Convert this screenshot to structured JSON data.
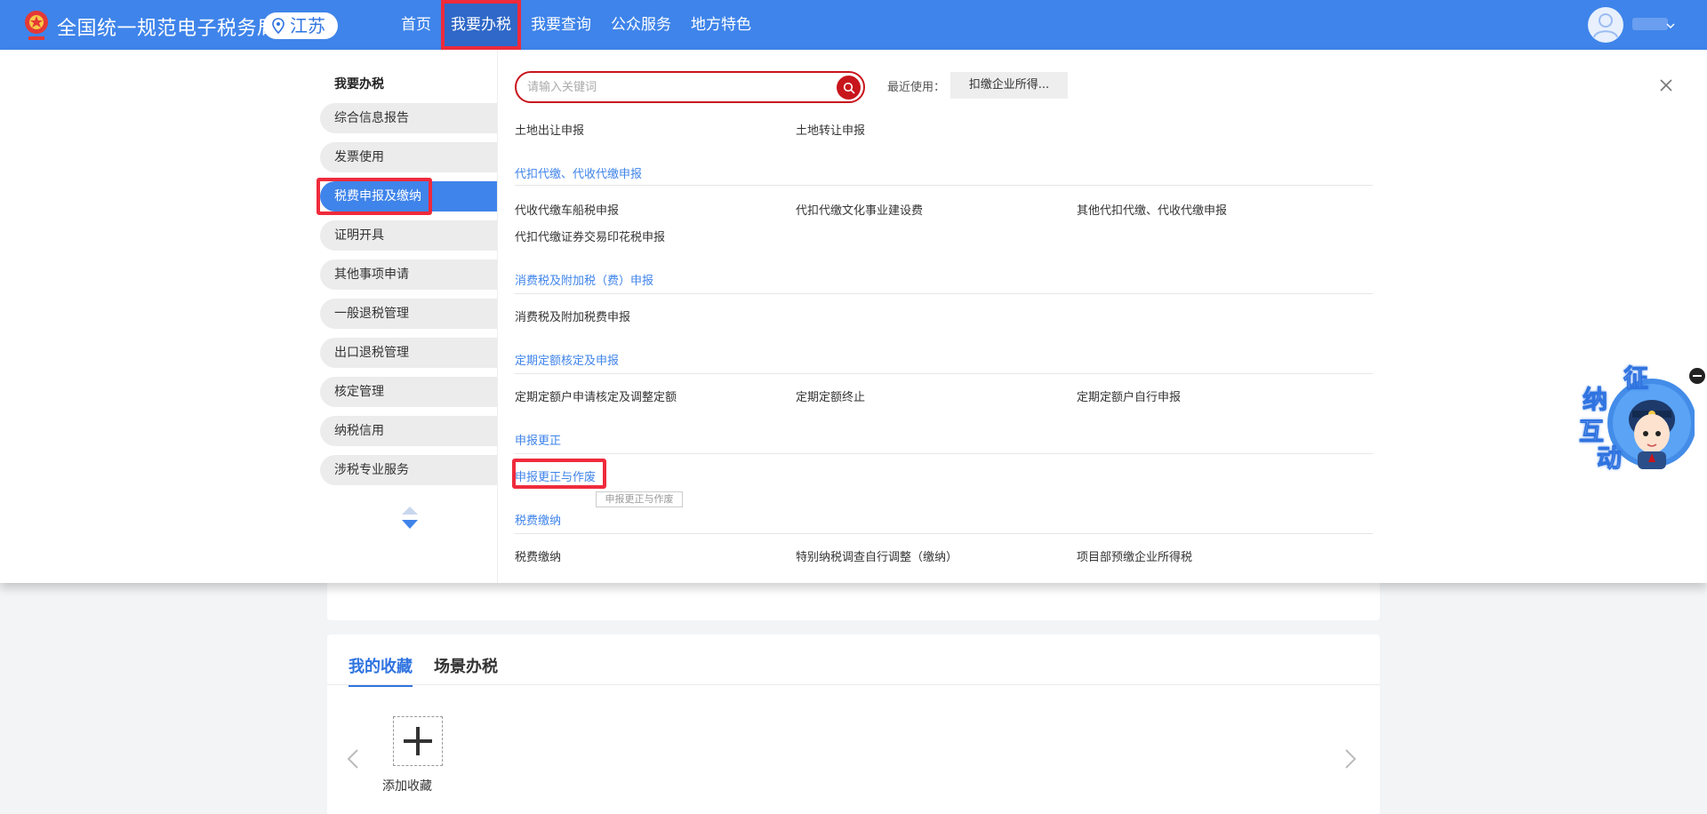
{
  "header": {
    "site_title": "全国统一规范电子税务局",
    "region": "江苏",
    "nav": [
      {
        "label": "首页"
      },
      {
        "label": "我要办税"
      },
      {
        "label": "我要查询"
      },
      {
        "label": "公众服务"
      },
      {
        "label": "地方特色"
      }
    ],
    "active_nav": "我要办税"
  },
  "dropdown": {
    "heading": "我要办税",
    "menu": [
      {
        "label": "综合信息报告"
      },
      {
        "label": "发票使用"
      },
      {
        "label": "税费申报及缴纳"
      },
      {
        "label": "证明开具"
      },
      {
        "label": "其他事项申请"
      },
      {
        "label": "一般退税管理"
      },
      {
        "label": "出口退税管理"
      },
      {
        "label": "核定管理"
      },
      {
        "label": "纳税信用"
      },
      {
        "label": "涉税专业服务"
      }
    ],
    "active_menu": "税费申报及缴纳",
    "search": {
      "placeholder": "请输入关键词"
    },
    "recent_label": "最近使用：",
    "recent_item": "扣缴企业所得...",
    "top_links": [
      "土地出让申报",
      "土地转让申报"
    ],
    "sections": [
      {
        "title": "代扣代缴、代收代缴申报",
        "links": [
          "代收代缴车船税申报",
          "代扣代缴文化事业建设费",
          "其他代扣代缴、代收代缴申报",
          "代扣代缴证券交易印花税申报"
        ]
      },
      {
        "title": "消费税及附加税（费）申报",
        "links": [
          "消费税及附加税费申报"
        ]
      },
      {
        "title": "定期定额核定及申报",
        "links": [
          "定期定额户申请核定及调整定额",
          "定期定额终止",
          "定期定额户自行申报"
        ]
      },
      {
        "title": "申报更正",
        "links": [
          "申报更正与作废"
        ]
      },
      {
        "title": "税费缴纳",
        "links": [
          "税费缴纳",
          "特别纳税调查自行调整（缴纳）",
          "项目部预缴企业所得税"
        ]
      }
    ],
    "tooltip": "申报更正与作废"
  },
  "favorites": {
    "tabs": [
      {
        "label": "我的收藏"
      },
      {
        "label": "场景办税"
      }
    ],
    "add_label": "添加收藏"
  },
  "mascot": {
    "chars": [
      "征",
      "纳",
      "互",
      "动"
    ]
  },
  "colors": {
    "brand": "#3f84ea",
    "search_red": "#c8151c",
    "highlight": "#ef2b3c"
  }
}
